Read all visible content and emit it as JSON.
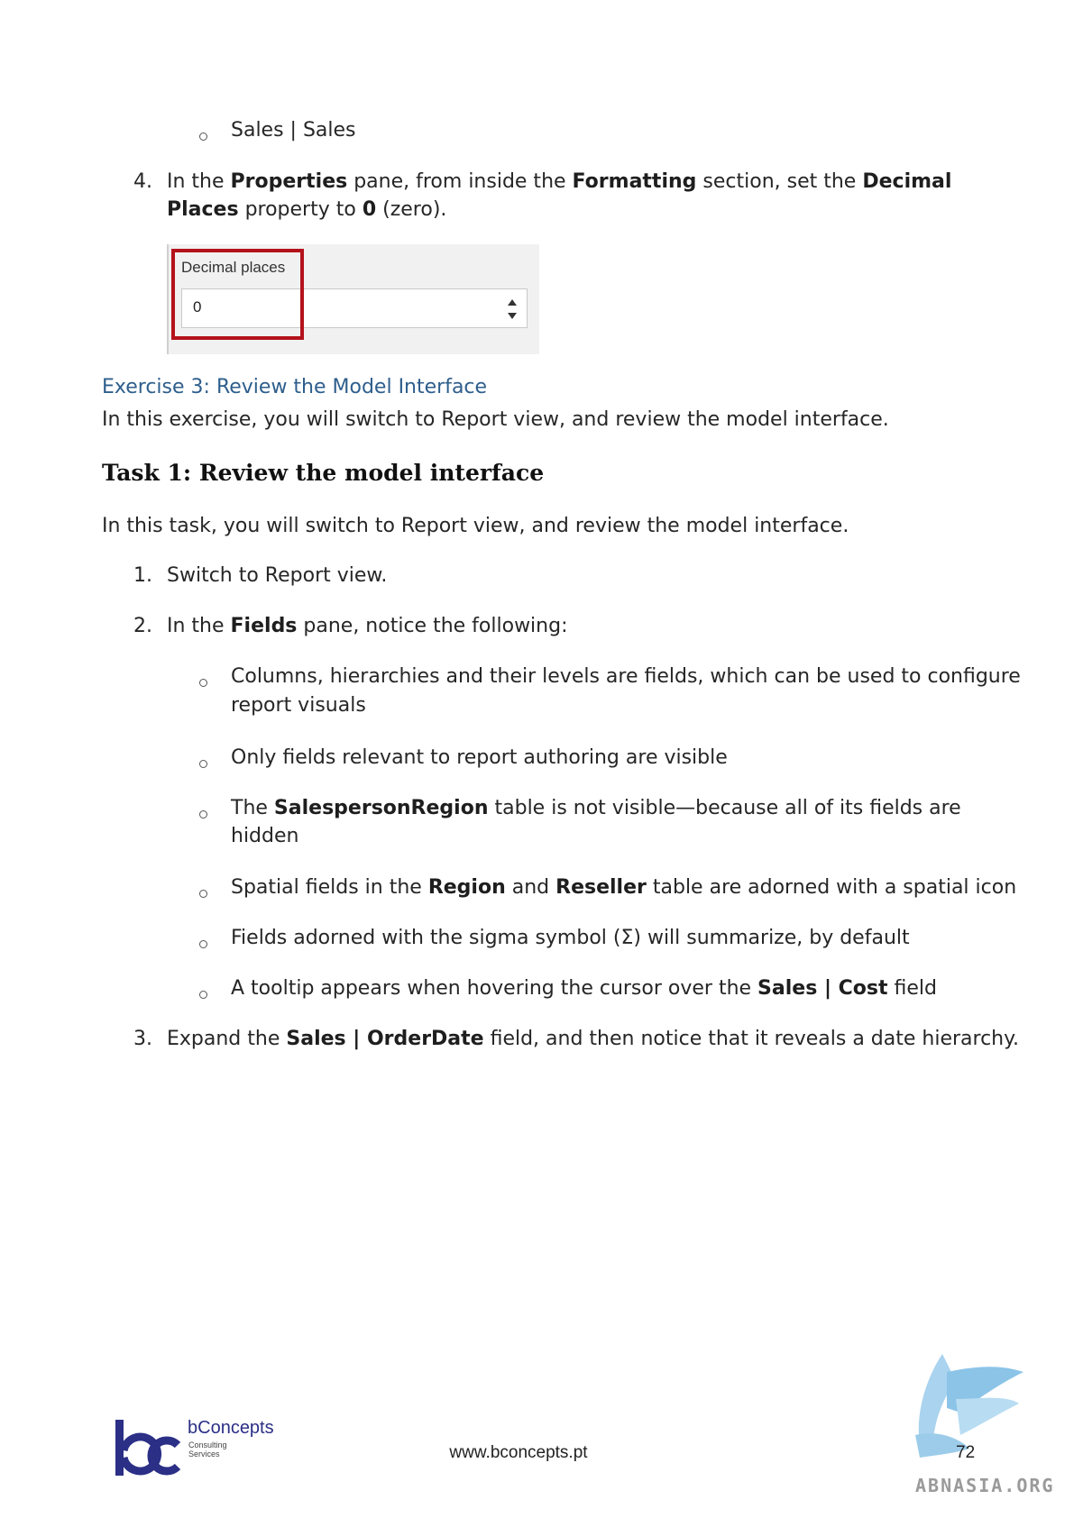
{
  "sub_bullet_top": "Sales | Sales",
  "step4": {
    "number": "4.",
    "line1_parts": [
      "In the ",
      "Properties",
      " pane, from inside the ",
      "Formatting",
      " section, set the ",
      "Decimal"
    ],
    "line2_parts": [
      "Places",
      " property to ",
      "0",
      " (zero)."
    ]
  },
  "decimal_control": {
    "label": "Decimal places",
    "value": "0"
  },
  "exercise_heading": "Exercise 3: Review the Model Interface",
  "exercise_intro": "In this exercise, you will switch to Report view, and review the model interface.",
  "task_heading": "Task 1: Review the model interface",
  "task_intro": "In this task, you will switch to Report view, and review the model interface.",
  "steps": [
    {
      "number": "1.",
      "text": "Switch to Report view."
    },
    {
      "number": "2.",
      "parts": [
        "In the ",
        "Fields",
        " pane, notice the following:"
      ]
    },
    {
      "number": "3.",
      "parts": [
        "Expand the ",
        "Sales | OrderDate",
        " field, and then notice that it reveals a date hierarchy."
      ]
    }
  ],
  "field_bullets": [
    {
      "line1": "Columns, hierarchies and their levels are fields, which can be used to configure",
      "line2": "report visuals"
    },
    {
      "line1": "Only fields relevant to report authoring are visible"
    },
    {
      "parts": [
        "The ",
        "SalespersonRegion",
        " table is not visible—because all of its fields are"
      ],
      "line2": "hidden"
    },
    {
      "parts": [
        "Spatial fields in the ",
        "Region",
        " and ",
        "Reseller",
        " table are adorned with a spatial icon"
      ]
    },
    {
      "line1": "Fields adorned with the sigma symbol (Σ) will summarize, by default"
    },
    {
      "parts": [
        "A tooltip appears when hovering the cursor over the ",
        "Sales | Cost",
        " field"
      ]
    }
  ],
  "footer": {
    "logo_brand": "bConcepts",
    "logo_sub1": "Consulting",
    "logo_sub2": "Services",
    "url": "www.bconcepts.pt",
    "page_number": "72",
    "watermark": "ABNASIA.ORG"
  },
  "colors": {
    "heading_blue": "#2e5e8c",
    "highlight_red": "#b4121b",
    "logo_navy": "#2b2f86"
  }
}
